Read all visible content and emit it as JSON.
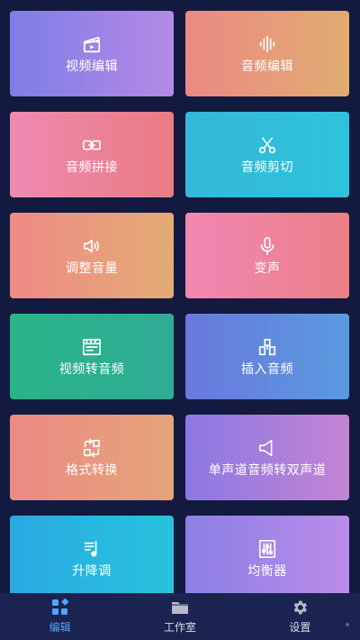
{
  "tiles": [
    {
      "label": "视频编辑",
      "icon": "clapperboard-icon"
    },
    {
      "label": "音频编辑",
      "icon": "waveform-icon"
    },
    {
      "label": "音频拼接",
      "icon": "link-icon"
    },
    {
      "label": "音频剪切",
      "icon": "scissors-icon"
    },
    {
      "label": "调整音量",
      "icon": "speaker-icon"
    },
    {
      "label": "变声",
      "icon": "microphone-icon"
    },
    {
      "label": "视频转音频",
      "icon": "video-window-icon"
    },
    {
      "label": "插入音频",
      "icon": "insert-blocks-icon"
    },
    {
      "label": "格式转换",
      "icon": "convert-icon"
    },
    {
      "label": "单声道音频转双声道",
      "icon": "mono-speaker-icon"
    },
    {
      "label": "升降调",
      "icon": "pitch-note-icon"
    },
    {
      "label": "均衡器",
      "icon": "equalizer-icon"
    }
  ],
  "tabs": [
    {
      "label": "编辑",
      "icon": "edit-grid-icon",
      "active": true
    },
    {
      "label": "工作室",
      "icon": "folder-icon",
      "active": false
    },
    {
      "label": "设置",
      "icon": "gear-icon",
      "active": false
    }
  ],
  "colors": {
    "background": "#131a3f",
    "tabbar": "#1b2350",
    "active_tab": "#4ea8f7"
  }
}
